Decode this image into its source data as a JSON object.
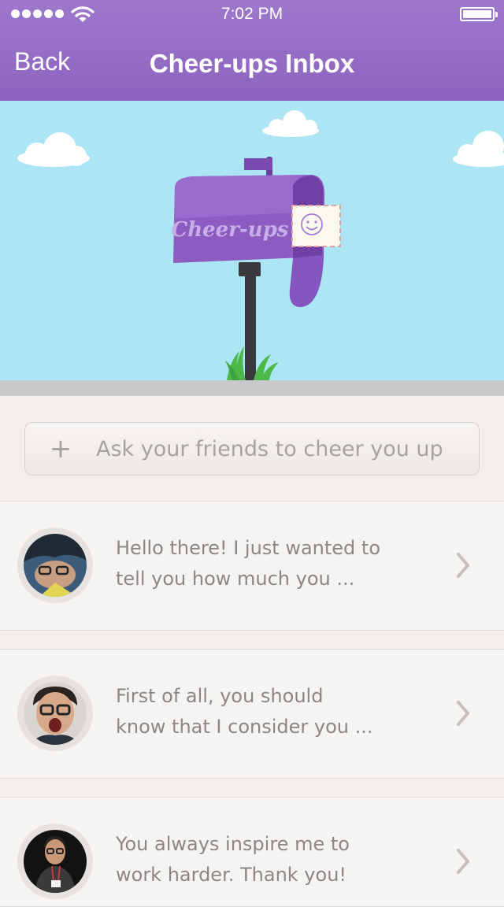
{
  "status_bar": {
    "time": "7:02 PM"
  },
  "nav": {
    "back_label": "Back",
    "title": "Cheer-ups Inbox"
  },
  "hero": {
    "mailbox_label": "Cheer-ups"
  },
  "ask_button": {
    "icon": "plus-icon",
    "label": "Ask your friends to cheer you up"
  },
  "messages": [
    {
      "line1": "Hello there! I just wanted to",
      "line2": "tell you how much you ..."
    },
    {
      "line1": "First of all, you should",
      "line2": "know that I consider you ..."
    },
    {
      "line1": "You always inspire me to",
      "line2": "work harder. Thank you!"
    }
  ],
  "colors": {
    "header": "#9270c4",
    "sky": "#ace6f5",
    "mailbox": "#8c5cc0",
    "background": "#f1eeeb"
  }
}
